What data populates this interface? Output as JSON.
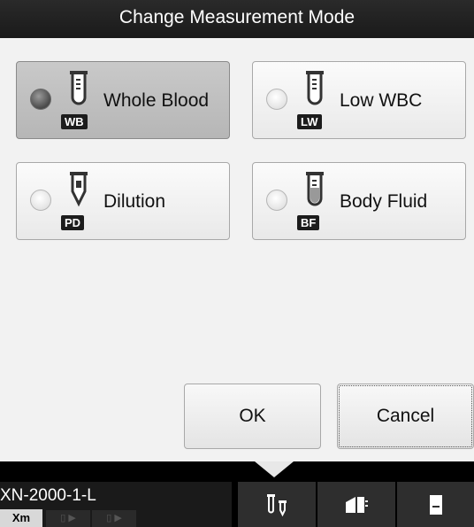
{
  "dialog": {
    "title": "Change Measurement Mode"
  },
  "modes": [
    {
      "label": "Whole Blood",
      "badge": "WB",
      "selected": true
    },
    {
      "label": "Low WBC",
      "badge": "LW",
      "selected": false
    },
    {
      "label": "Dilution",
      "badge": "PD",
      "selected": false
    },
    {
      "label": "Body Fluid",
      "badge": "BF",
      "selected": false
    }
  ],
  "buttons": {
    "ok": "OK",
    "cancel": "Cancel"
  },
  "taskbar": {
    "device_name": "XN-2000-1-L",
    "xm_label": "Xm",
    "icons": [
      "sample-tubes-icon",
      "reagent-icon",
      "analyzer-icon"
    ]
  }
}
